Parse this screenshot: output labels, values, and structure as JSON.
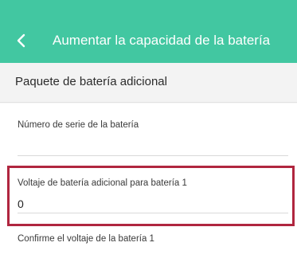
{
  "header": {
    "back_icon": "chevron-left-icon",
    "title": "Aumentar la capacidad de la batería"
  },
  "section": {
    "title": "Paquete de batería adicional"
  },
  "form": {
    "serial_label": "Número de serie de la batería",
    "serial_value": "",
    "voltage_label": "Voltaje de batería adicional para batería 1",
    "voltage_value": "0",
    "confirm_label": "Confirme el voltaje de la batería 1"
  },
  "colors": {
    "header_bg": "#42c7a1",
    "highlight_border": "#b0263f"
  }
}
